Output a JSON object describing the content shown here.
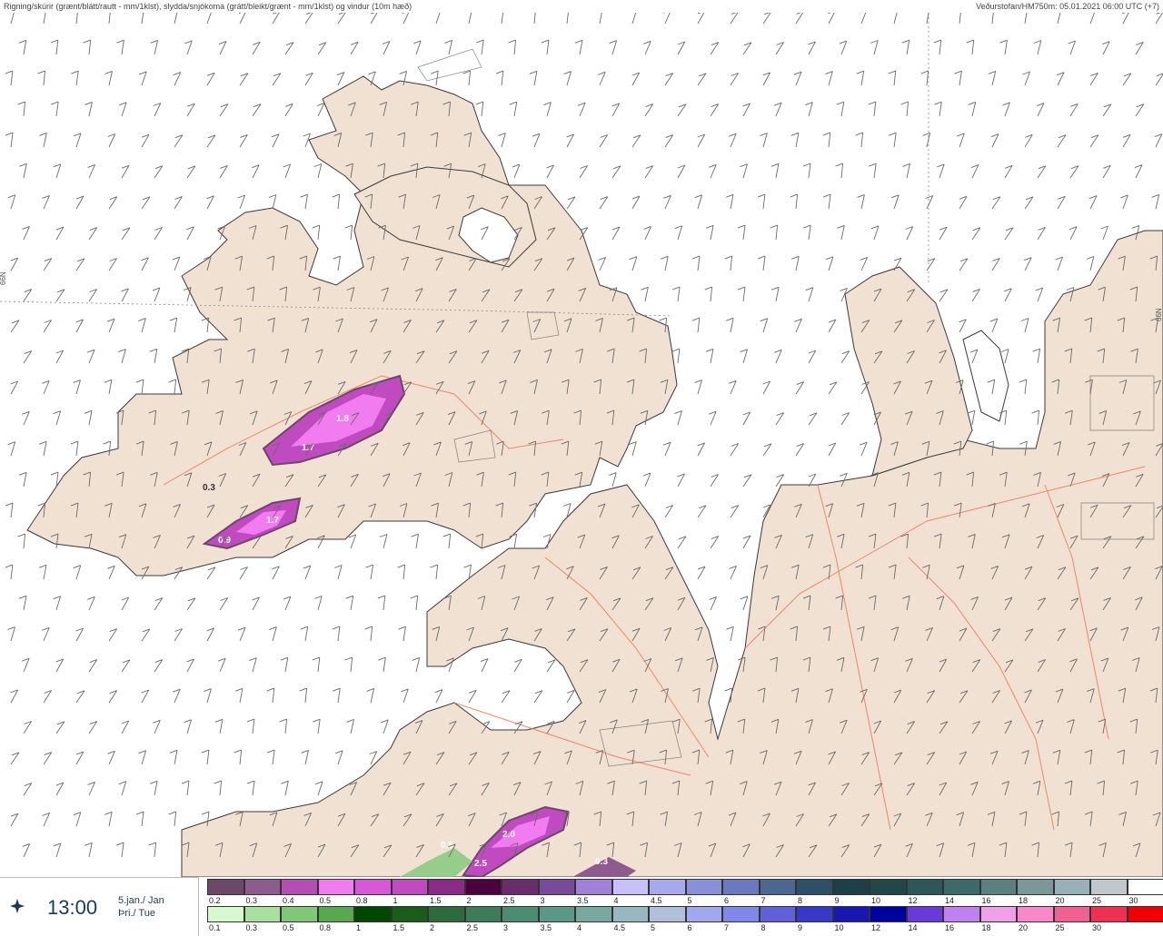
{
  "header": {
    "left": "Rigning/skúrir (grænt/blátt/rautt - mm/1klst), slydda/snjókoma (grátt/bleikt/grænt - mm/1klst) og vindur (10m hæð)",
    "right": "Veðurstofan/HM750m: 05.01.2021 06:00 UTC (+7)"
  },
  "map": {
    "lat_label_left": "66N",
    "lat_label_right": "66N",
    "precip_labels": [
      "1.8",
      "1.7",
      "1.7",
      "0.9",
      "0.3",
      "2.0",
      "2.5",
      "0.5",
      "0.3"
    ],
    "colors": {
      "land": "#f0e1d3",
      "coast": "#3a3a3a",
      "road": "#f07850",
      "barb": "#6a6a6a"
    }
  },
  "time_panel": {
    "time": "13:00",
    "date_line1": "5.jan./ Jan",
    "date_line2": "Þri./ Tue",
    "icon": "compass-icon"
  },
  "legend": {
    "snow_colors": [
      "#6b4868",
      "#8e5b8f",
      "#b44eb3",
      "#f07cf0",
      "#d658d6",
      "#c04ac0",
      "#882c88",
      "#4d003f",
      "#6a2c6a",
      "#7a4a9a",
      "#a080d8",
      "#c8c0f8",
      "#a8a8ec",
      "#8890d8",
      "#6a78c0",
      "#4a6890",
      "#2c5068",
      "#1c4048",
      "#204848",
      "#2c5858",
      "#3c6a6a",
      "#5a8080",
      "#7a9898",
      "#98b0b8",
      "#c0c8cc",
      "#ffffff"
    ],
    "snow_labels": [
      "0.2",
      "0.3",
      "0.4",
      "0.5",
      "0.8",
      "1",
      "1.5",
      "2",
      "2.5",
      "3",
      "3.5",
      "4",
      "4.5",
      "5",
      "6",
      "7",
      "8",
      "9",
      "10",
      "12",
      "14",
      "16",
      "18",
      "20",
      "25",
      "30"
    ],
    "rain_colors": [
      "#d8f8d0",
      "#a8e0a0",
      "#80c878",
      "#58a850",
      "#004800",
      "#1a5c1a",
      "#2c6c3c",
      "#3c7c58",
      "#4c8c70",
      "#5c9888",
      "#78a8a0",
      "#98b8c0",
      "#b0c0dc",
      "#a0a8f0",
      "#8088e8",
      "#6060d8",
      "#3838c8",
      "#1818b0",
      "#0000a0",
      "#6a3ad8",
      "#c080f0",
      "#f0a0e8",
      "#f888c8",
      "#f06090",
      "#f03050",
      "#f00000"
    ],
    "rain_labels": [
      "0.1",
      "0.3",
      "0.5",
      "0.8",
      "1",
      "1.5",
      "2",
      "2.5",
      "3",
      "3.5",
      "4",
      "4.5",
      "5",
      "6",
      "7",
      "8",
      "9",
      "10",
      "12",
      "14",
      "16",
      "18",
      "20",
      "25",
      "30",
      ""
    ]
  }
}
